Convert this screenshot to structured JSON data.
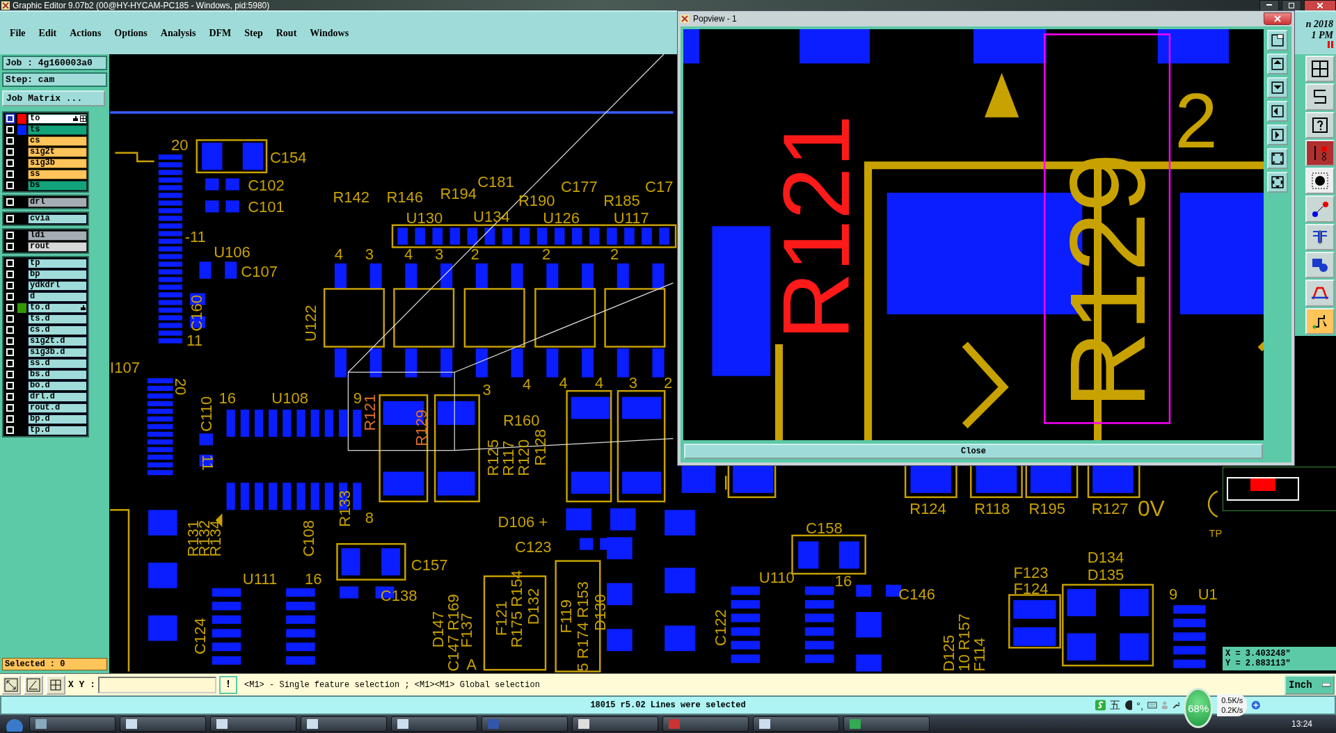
{
  "window": {
    "title": "Graphic Editor 9.07b2 (00@HY-HYCAM-PC185 - Windows, pid:5980)"
  },
  "menu": [
    "File",
    "Edit",
    "Actions",
    "Options",
    "Analysis",
    "DFM",
    "Step",
    "Rout",
    "Windows"
  ],
  "clock": {
    "date": "n 2018",
    "time": "1 PM"
  },
  "job": {
    "job": "Job : 4g160003a0",
    "step": "Step: cam",
    "matrix_button": "Job Matrix ..."
  },
  "layer_groups": [
    {
      "layers": [
        {
          "name": "to",
          "kind": "mask",
          "selected": true,
          "affected": true,
          "color": "#ff0000"
        },
        {
          "name": "ts",
          "kind": "mask",
          "selected": false,
          "affected": false,
          "color": "#0022ff"
        },
        {
          "name": "cs",
          "kind": "signal",
          "selected": false,
          "affected": false
        },
        {
          "name": "sig2t",
          "kind": "signal",
          "selected": false,
          "affected": false
        },
        {
          "name": "sig3b",
          "kind": "signal",
          "selected": false,
          "affected": false
        },
        {
          "name": "ss",
          "kind": "signal",
          "selected": false,
          "affected": false
        },
        {
          "name": "bs",
          "kind": "mask",
          "selected": false,
          "affected": false
        }
      ]
    },
    {
      "layers": [
        {
          "name": "drl",
          "kind": "drill",
          "selected": false,
          "affected": false
        }
      ]
    },
    {
      "layers": [
        {
          "name": "cvia",
          "kind": "document",
          "selected": false,
          "affected": false
        }
      ]
    },
    {
      "layers": [
        {
          "name": "ldi",
          "kind": "drill",
          "selected": false,
          "affected": false
        },
        {
          "name": "rout",
          "kind": "rout",
          "selected": false,
          "affected": false
        }
      ]
    },
    {
      "layers": [
        {
          "name": "tp",
          "kind": "document",
          "selected": false,
          "affected": false
        },
        {
          "name": "bp",
          "kind": "document",
          "selected": false,
          "affected": false
        },
        {
          "name": "ydkdrl",
          "kind": "document",
          "selected": false,
          "affected": false
        },
        {
          "name": "d",
          "kind": "document",
          "selected": false,
          "affected": false
        },
        {
          "name": "to.d",
          "kind": "document",
          "selected": false,
          "affected": true,
          "color": "#339900"
        },
        {
          "name": "ts.d",
          "kind": "document",
          "selected": false,
          "affected": false
        },
        {
          "name": "cs.d",
          "kind": "document",
          "selected": false,
          "affected": false
        },
        {
          "name": "sig2t.d",
          "kind": "document",
          "selected": false,
          "affected": false
        },
        {
          "name": "sig3b.d",
          "kind": "document",
          "selected": false,
          "affected": false
        },
        {
          "name": "ss.d",
          "kind": "document",
          "selected": false,
          "affected": false
        },
        {
          "name": "bs.d",
          "kind": "document",
          "selected": false,
          "affected": false
        },
        {
          "name": "bo.d",
          "kind": "document",
          "selected": false,
          "affected": false
        },
        {
          "name": "drl.d",
          "kind": "document",
          "selected": false,
          "affected": false
        },
        {
          "name": "rout.d",
          "kind": "document",
          "selected": false,
          "affected": false
        },
        {
          "name": "bp.d",
          "kind": "document",
          "selected": false,
          "affected": false
        },
        {
          "name": "tp.d",
          "kind": "document",
          "selected": false,
          "affected": false
        }
      ]
    }
  ],
  "selected_count": "Selected : 0",
  "canvas_labels": [
    "20",
    "C154",
    "C102",
    "C101",
    "-11",
    "R142",
    "R146",
    "R194",
    "C181",
    "C177",
    "C17",
    "R190",
    "R185",
    "U130",
    "U134",
    "U126",
    "U117",
    "U106",
    "C107",
    "C160",
    "11",
    "U122",
    "I107",
    "20",
    "16",
    "U108",
    "C110",
    "11",
    "R160",
    "R125",
    "R117",
    "R120",
    "R128",
    "8",
    "D106 +",
    "C123",
    "C157",
    "U111",
    "16",
    "C138",
    "R131",
    "R132",
    "R134",
    "C108",
    "R133",
    "C124",
    "D147",
    "C147 R169",
    "F137",
    "F121",
    "R175 R154",
    "D132",
    "F119",
    "5 R174 R153",
    "D130",
    "C122",
    "U110",
    "16",
    "C146",
    "C158",
    "D125",
    "10 R157",
    "F114",
    "F123",
    "F124",
    "D134",
    "D135",
    "9",
    "U1",
    "R124",
    "R118",
    "R195",
    "R127",
    "0V",
    "TP",
    "A",
    "4",
    "3",
    "4",
    "3",
    "2",
    "2",
    "2",
    "9",
    "3",
    "4",
    "4",
    "4",
    "3",
    "2",
    "R121",
    "R129"
  ],
  "popview": {
    "title": "Popview - 1",
    "labels": [
      "R121",
      "R129",
      "2"
    ],
    "close_button": "Close"
  },
  "coordinates": {
    "x": "X = 3.403248\"",
    "y": "Y = 2.883113\""
  },
  "command_bar": {
    "xy_label": "X Y :",
    "hint_button": "!",
    "message": "<M1> - Single feature selection ; <M1><M1> Global selection",
    "unit": "Inch"
  },
  "status": "18015 r5.02 Lines were selected",
  "tray": {
    "ime": "五",
    "punct": "°,",
    "cpu": "68%",
    "upload": "0.5K/s",
    "download": "0.2K/s"
  },
  "taskbar": {
    "time": "13:24"
  }
}
